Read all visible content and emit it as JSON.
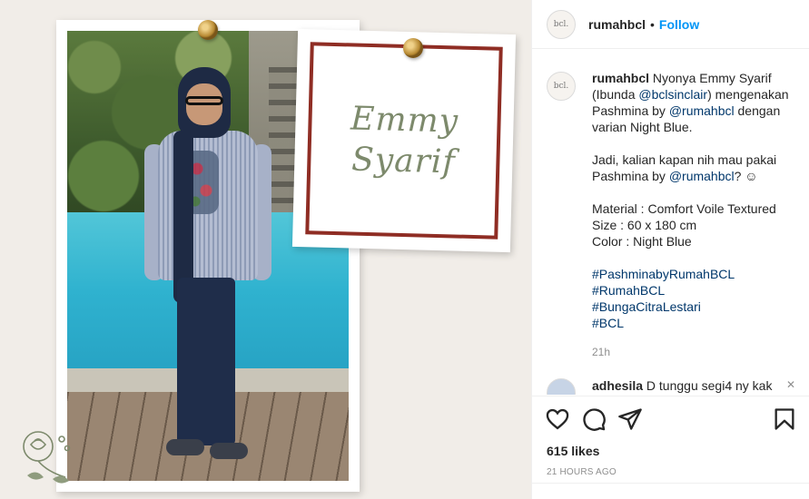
{
  "post": {
    "card_name_line1": "Emmy",
    "card_name_line2": "Syarif"
  },
  "header": {
    "avatar_text": "bcl.",
    "username": "rumahbcl",
    "separator": "•",
    "follow_label": "Follow"
  },
  "caption": {
    "avatar_text": "bcl.",
    "username": "rumahbcl",
    "text_1a": " Nyonya Emmy Syarif (Ibunda ",
    "mention_1": "@bclsinclair",
    "text_1b": ") mengenakan Pashmina by ",
    "mention_2": "@rumahbcl",
    "text_1c": " dengan varian Night Blue.",
    "text_2a": "Jadi, kalian kapan nih mau pakai Pashmina by ",
    "mention_3": "@rumahbcl",
    "text_2b": "? ☺",
    "material": "Material : Comfort Voile Textured",
    "size": "Size : 60 x 180 cm",
    "color": "Color : Night Blue",
    "hashtags": [
      "#PashminabyRumahBCL",
      "#RumahBCL",
      "#BungaCitraLestari",
      "#BCL"
    ],
    "time_ago": "21h"
  },
  "comment": {
    "username": "adhesila",
    "text": " D tunggu segi4 ny kak",
    "close": "✕"
  },
  "actions": {
    "icons": [
      "heart-icon",
      "comment-icon",
      "share-icon",
      "bookmark-icon"
    ],
    "likes": "615 likes",
    "date": "21 HOURS AGO"
  },
  "colors": {
    "link": "#0095f6",
    "mention": "#00376b",
    "card_border": "#8f2d24",
    "script": "#7d8a6c"
  }
}
